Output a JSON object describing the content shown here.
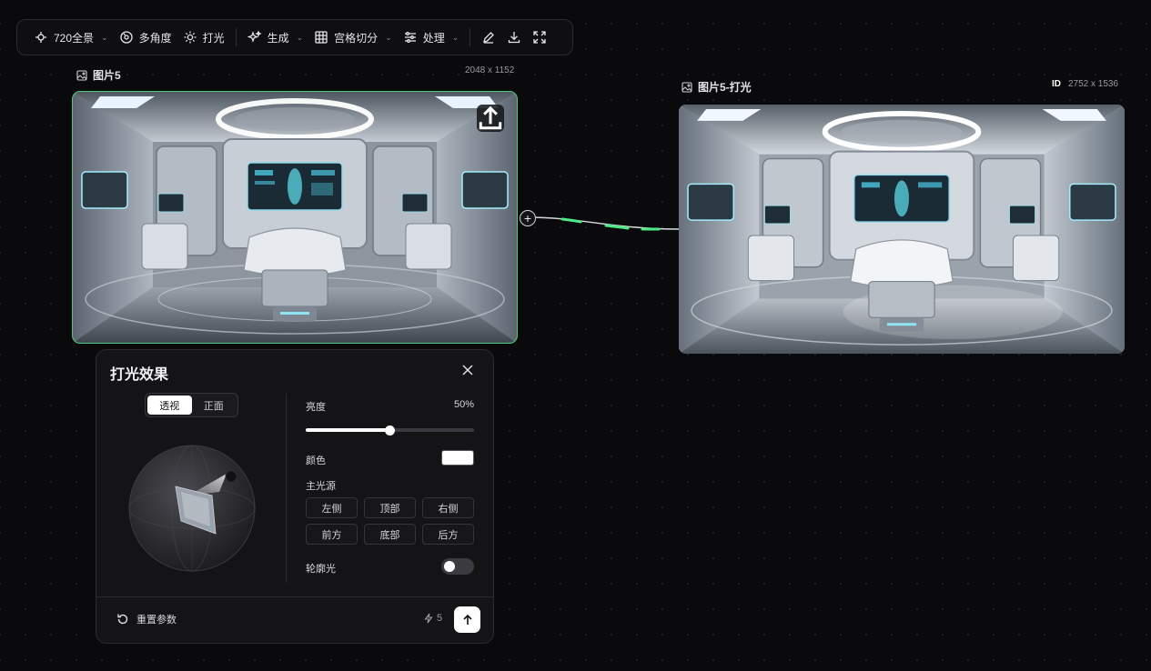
{
  "toolbar": {
    "panorama_label": "720全景",
    "multi_angle_label": "多角度",
    "lighting_label": "打光",
    "generate_label": "生成",
    "grid_cut_label": "宫格切分",
    "process_label": "处理"
  },
  "source_image": {
    "label": "图片5",
    "dimensions": "2048 x 1152"
  },
  "result_image": {
    "label": "图片5-打光",
    "id_badge": "ID",
    "dimensions": "2752 x 1536"
  },
  "lighting_panel": {
    "title": "打光效果",
    "view_tabs": [
      {
        "label": "透视",
        "active": true
      },
      {
        "label": "正面",
        "active": false
      }
    ],
    "brightness_label": "亮度",
    "brightness_value": "50%",
    "brightness_fraction": 0.5,
    "color_label": "颜色",
    "color_value": "#ffffff",
    "main_light_label": "主光源",
    "directions": [
      "左侧",
      "顶部",
      "右侧",
      "前方",
      "底部",
      "后方"
    ],
    "rim_light_label": "轮廓光",
    "rim_light_on": false,
    "reset_label": "重置参数",
    "credits": "5"
  },
  "colors": {
    "accent_green": "#4ec97a",
    "background": "#0a0a0c"
  }
}
